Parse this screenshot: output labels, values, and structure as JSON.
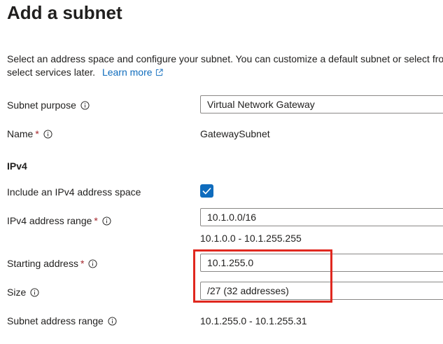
{
  "page": {
    "title": "Add a subnet",
    "description_line1": "Select an address space and configure your subnet. You can customize a default subnet or select from",
    "description_line2": "select services later.",
    "learn_more": "Learn more"
  },
  "form": {
    "subnet_purpose": {
      "label": "Subnet purpose",
      "value": "Virtual Network Gateway"
    },
    "name": {
      "label": "Name",
      "required": "*",
      "value": "GatewaySubnet"
    },
    "ipv4_section": "IPv4",
    "include_ipv4": {
      "label": "Include an IPv4 address space",
      "checked": true
    },
    "ipv4_range": {
      "label": "IPv4 address range",
      "required": "*",
      "value": "10.1.0.0/16",
      "range_text": "10.1.0.0 - 10.1.255.255"
    },
    "starting_address": {
      "label": "Starting address",
      "required": "*",
      "value": "10.1.255.0"
    },
    "size": {
      "label": "Size",
      "value": "/27 (32 addresses)"
    },
    "subnet_address_range": {
      "label": "Subnet address range",
      "value": "10.1.255.0 - 10.1.255.31"
    }
  },
  "colors": {
    "accent": "#0f6cbd",
    "required": "#a4262c",
    "highlight": "#e0281f"
  }
}
